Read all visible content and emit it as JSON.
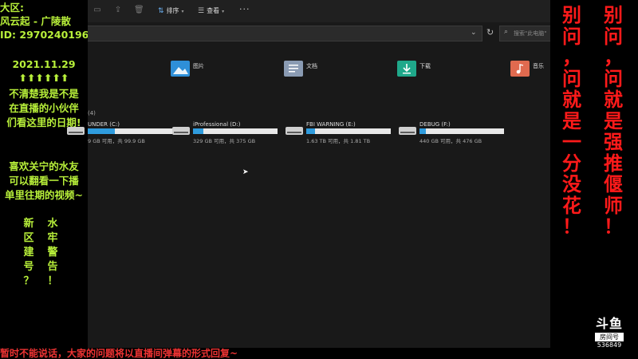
{
  "left_panel": {
    "line1": "大区:",
    "line2": "风云起 - 广陵散",
    "line3": "ID: 2970240196",
    "date": "2021.11.29",
    "arrows": "⬆⬆⬆⬆⬆⬆",
    "note1": "不清楚我是不是",
    "note2": "在直播的小伙伴",
    "note3": "们看这里的日期!",
    "fan1": "喜欢关宁的水友",
    "fan2": "可以翻看一下播",
    "fan3": "单里往期的视频~",
    "col1": [
      "新",
      "区",
      "建",
      "号",
      "？"
    ],
    "col2": [
      "水",
      "牢",
      "警",
      "告",
      "！"
    ]
  },
  "right_panel": {
    "col1": [
      "别",
      "问",
      "，",
      "问",
      "就",
      "是",
      "一",
      "分",
      "没",
      "花",
      "！"
    ],
    "col2": [
      "别",
      "问",
      "，",
      "问",
      "就",
      "是",
      "强",
      "推",
      "偃",
      "师",
      "！"
    ],
    "logo_mark": "斗鱼",
    "logo_sub": "房间号",
    "room_id": "536849"
  },
  "explorer": {
    "toolbar": {
      "sort_label": "排序",
      "view_label": "查看",
      "more_label": "···"
    },
    "search_placeholder": "搜索\"此电脑\"",
    "folders": [
      {
        "name": "图片",
        "color": "#2e8fd8"
      },
      {
        "name": "文档",
        "color": "#8a9bb3"
      },
      {
        "name": "下载",
        "color": "#1fa88a"
      },
      {
        "name": "音乐",
        "color": "#e06a4f"
      }
    ],
    "drives_header": "(4)",
    "drives": [
      {
        "name": "UNDER (C:)",
        "size": "9 GB 可用，共 99.9 GB",
        "used_fraction": 0.32
      },
      {
        "name": "iProfessional (D:)",
        "size": "329 GB 可用，共 375 GB",
        "used_fraction": 0.12
      },
      {
        "name": "FBI WARNING (E:)",
        "size": "1.63 TB 可用，共 1.81 TB",
        "used_fraction": 0.1
      },
      {
        "name": "DEBUG (F:)",
        "size": "440 GB 可用，共 476 GB",
        "used_fraction": 0.08
      }
    ]
  },
  "bottom_bar": {
    "text": "暂时不能说话，大家的问题将以直播间弹幕的形式回复~"
  }
}
